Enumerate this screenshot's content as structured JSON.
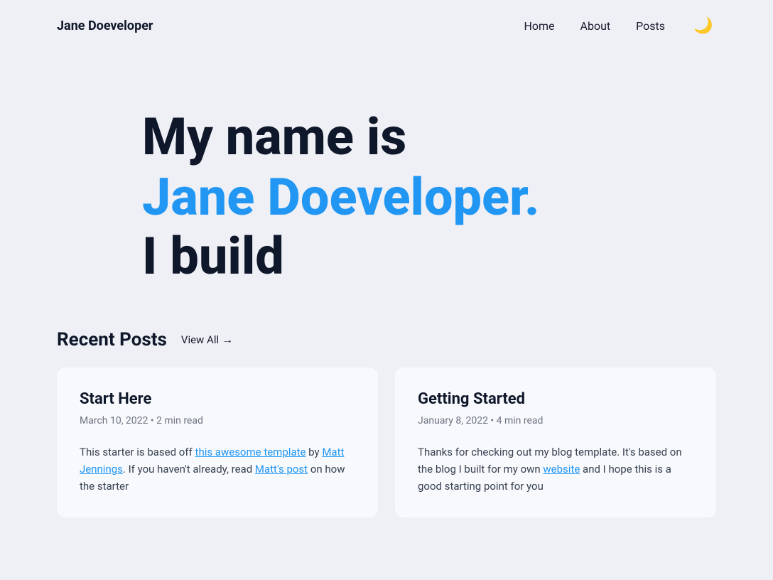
{
  "nav": {
    "logo": "Jane Doeveloper",
    "links": [
      {
        "label": "Home",
        "href": "#"
      },
      {
        "label": "About",
        "href": "#"
      },
      {
        "label": "Posts",
        "href": "#"
      }
    ],
    "dark_mode_icon": "🌙"
  },
  "hero": {
    "line1": "My name is",
    "line2": "Jane Doeveloper.",
    "line3": "I build"
  },
  "recent_posts": {
    "section_title": "Recent Posts",
    "view_all_label": "View All",
    "cards": [
      {
        "title": "Start Here",
        "date": "March 10, 2022",
        "read_time": "2 min read",
        "excerpt_before_link1": "This starter is based off ",
        "link1_text": "this awesome template",
        "excerpt_between": " by ",
        "link2_text": "Matt Jennings",
        "excerpt_after_link2": ". If you haven't already, read ",
        "link3_text": "Matt's post",
        "excerpt_end": " on how the starter"
      },
      {
        "title": "Getting Started",
        "date": "January 8, 2022",
        "read_time": "4 min read",
        "excerpt": "Thanks for checking out my blog template. It's based on the blog I built for my own ",
        "link_text": "website",
        "excerpt_end": " and I hope this is a good starting point for you"
      }
    ]
  }
}
